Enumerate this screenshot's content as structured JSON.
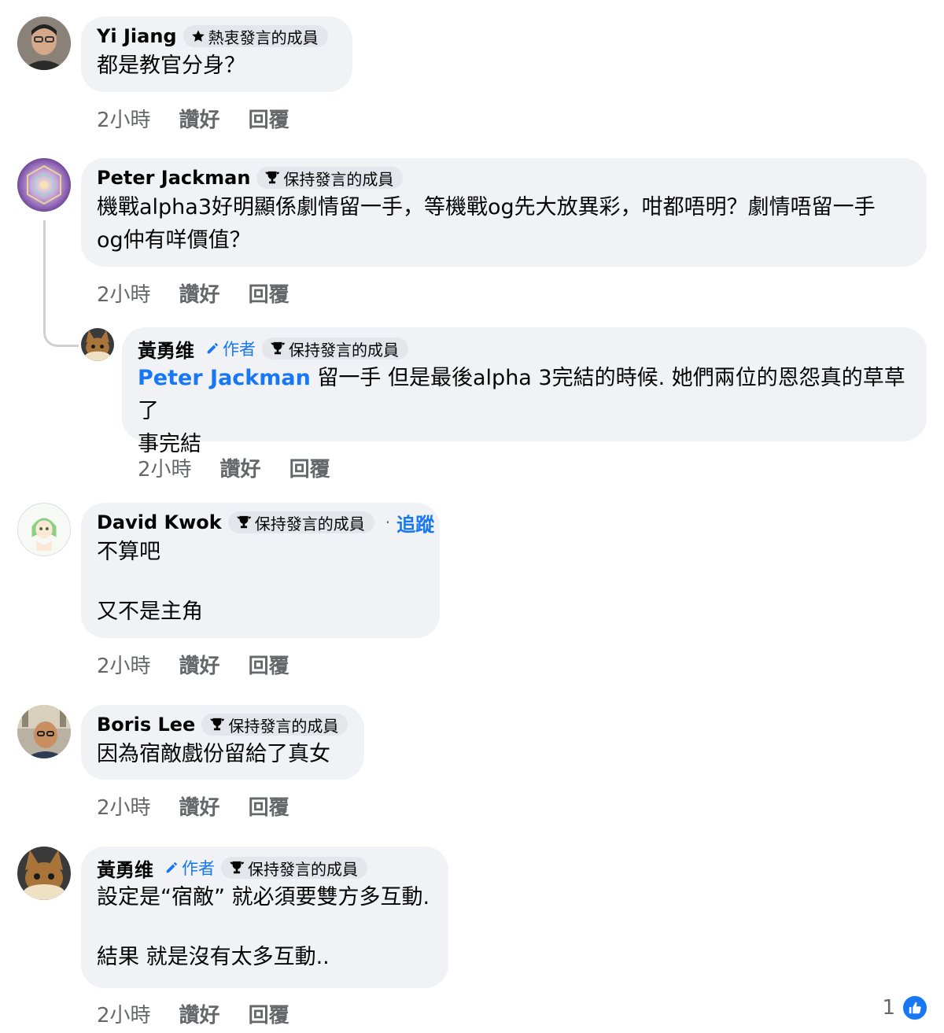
{
  "labels": {
    "time": "2小時",
    "like": "讚好",
    "reply": "回覆",
    "author": "作者",
    "follow": "追蹤"
  },
  "comments": [
    {
      "name": "Yi Jiang",
      "badge": "熱衷發言的成員",
      "badge_icon": "star-icon",
      "lines": [
        "都是教官分身？"
      ]
    },
    {
      "name": "Peter Jackman",
      "badge": "保持發言的成員",
      "badge_icon": "trophy-icon",
      "lines": [
        "機戰alpha3好明顯係劇情留一手，等機戰og先大放異彩，咁都唔明？劇情唔留一手",
        "og仲有咩價值？"
      ]
    },
    {
      "name": "黃勇维",
      "badge": "保持發言的成員",
      "badge_icon": "trophy-icon",
      "mention": "Peter Jackman",
      "lines": [
        " 留一手 但是最後alpha 3完結的時候. 她們兩位的恩怨真的草草了",
        "事完結"
      ]
    },
    {
      "name": "David Kwok",
      "badge": "保持發言的成員",
      "badge_icon": "trophy-icon",
      "lines": [
        "不算吧",
        "",
        "又不是主角"
      ]
    },
    {
      "name": "Boris Lee",
      "badge": "保持發言的成員",
      "badge_icon": "trophy-icon",
      "lines": [
        "因為宿敵戲份留給了真女"
      ]
    },
    {
      "name": "黃勇维",
      "badge": "保持發言的成員",
      "badge_icon": "trophy-icon",
      "lines": [
        "設定是“宿敵” 就必須要雙方多互動.",
        "",
        "結果 就是沒有太多互動.."
      ]
    }
  ],
  "reaction_summary": {
    "count": "1",
    "icon": "like-icon"
  },
  "colors": {
    "bubble": "#f0f2f5",
    "link": "#1877f2",
    "meta": "#65676b"
  }
}
